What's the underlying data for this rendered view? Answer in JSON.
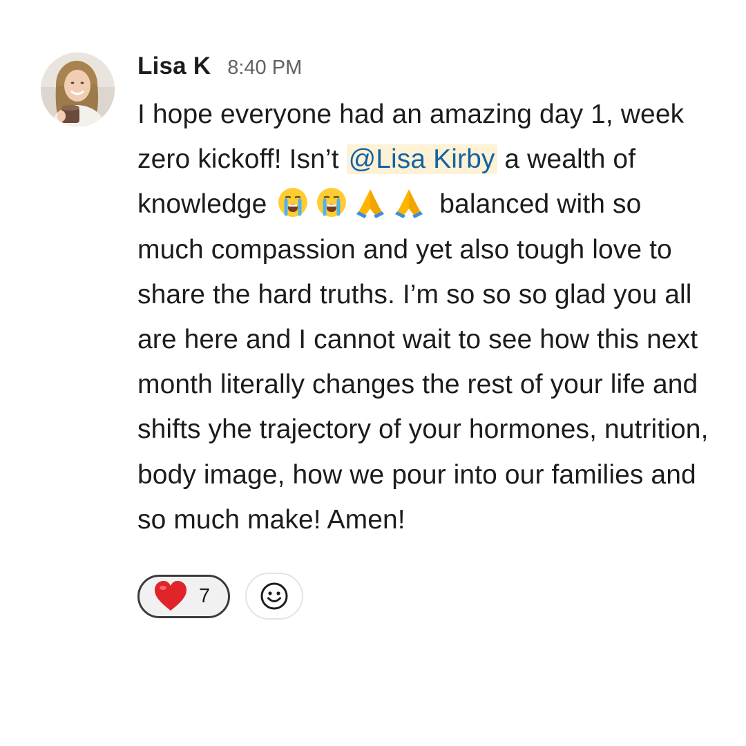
{
  "message": {
    "author": "Lisa K",
    "timestamp": "8:40 PM",
    "text_before_mention": "I hope everyone had an amazing day 1, week zero kickoff! Isn’t ",
    "mention": "@Lisa Kirby",
    "text_after_mention": " a wealth of knowledge",
    "emojis": [
      "loudly-crying-face-emoji",
      "loudly-crying-face-emoji",
      "folded-hands-emoji",
      "folded-hands-emoji"
    ],
    "text_after_emojis": " balanced with so much compassion and yet also tough love to share the hard truths. I’m so so so glad you all are here and I cannot wait to see how this next month literally changes the rest of your life and shifts yhe trajectory of your hormones, nutrition, body image, how we pour into our families and so much make! Amen!",
    "mention_color": "#1264a3",
    "mention_bg": "#fdf1d6"
  },
  "reactions": [
    {
      "icon": "red-heart-emoji",
      "count": "7"
    }
  ],
  "add_reaction_icon": "smiley-add-reaction-icon"
}
